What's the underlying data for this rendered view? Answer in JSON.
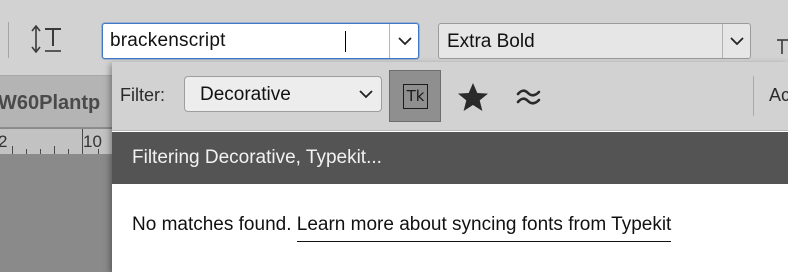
{
  "options_bar": {
    "font_family_value": "brackenscript",
    "font_style_value": "Extra Bold"
  },
  "document": {
    "tab_title": "W60Plantp",
    "ruler_labels": [
      "2",
      "10"
    ]
  },
  "font_panel": {
    "filter_label": "Filter:",
    "filter_value": "Decorative",
    "typekit_button": "Tk",
    "add_fonts_cut_label": "Ac",
    "status_text": "Filtering Decorative, Typekit...",
    "no_match_text": "No matches found.",
    "learn_more_link": "Learn more about syncing fonts from Typekit"
  },
  "icons": [
    "text-orientation-icon",
    "chevron-down-icon",
    "font-size-icon",
    "typekit-icon",
    "star-icon",
    "similar-fonts-icon"
  ],
  "colors": {
    "focus_border": "#3f78c9",
    "status_strip_bg": "#545454",
    "toolbar_bg": "#d2d2d2"
  }
}
